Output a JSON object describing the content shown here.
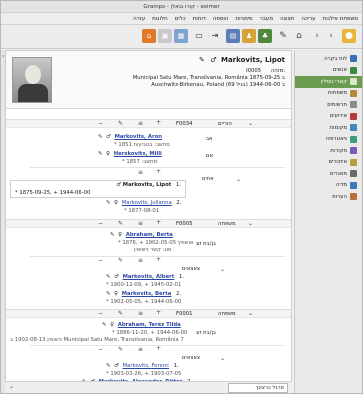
{
  "window": {
    "title": "Gramps - קורו גנאלן - eximer"
  },
  "menu": [
    "משפחת אילנות",
    "עריכה",
    "תצוגה",
    "מעבר",
    "סימניות",
    "הוספה",
    "דוחות",
    "כלים",
    "חלונות",
    "עזרה"
  ],
  "toolbar": {
    "icons": [
      "person-add-icon",
      "family-icon",
      "tree-icon",
      "edit-icon",
      "back-icon",
      "forward-icon",
      "home-icon",
      "tag-icon",
      "print-icon",
      "config-icon",
      "export-icon",
      "refresh-icon",
      "chart-icon",
      "bookmark-icon",
      "view-icon"
    ]
  },
  "sidebar": {
    "items": [
      {
        "label": "לוח בקרה",
        "color": "#3b6fb7"
      },
      {
        "label": "אנשים",
        "color": "#3b8a3b"
      },
      {
        "label": "קשרי גומלין",
        "color": "#5b8a34",
        "active": true
      },
      {
        "label": "משפחות",
        "color": "#b78a3b"
      },
      {
        "label": "תרשימים",
        "color": "#8a8a8a"
      },
      {
        "label": "אירועים",
        "color": "#b73b3b"
      },
      {
        "label": "מקומות",
        "color": "#3b8ab7"
      },
      {
        "label": "גיאוגרפיה",
        "color": "#3ba07a"
      },
      {
        "label": "מקורות",
        "color": "#7a5bb7"
      },
      {
        "label": "איזכורים",
        "color": "#b7a03b"
      },
      {
        "label": "מאגרים",
        "color": "#6a6a6a"
      },
      {
        "label": "מדיה",
        "color": "#3b7ab7"
      },
      {
        "label": "הערות",
        "color": "#b7703b"
      }
    ]
  },
  "person": {
    "name": "Markovits, Lipot",
    "id_label": "מזהה:",
    "id": "I0005",
    "birth": "Municipal Satu Mare, Transilvania, România ב 1875-09-25",
    "death": "Auschwitz-Birkenau, Poland ב 1944-06-00 (בגיל 69)"
  },
  "parents": {
    "section_label": "הוריים",
    "id": "F0034",
    "father_label": "אב",
    "father": "Markovits, Aron",
    "father_note": "* מחשב: בטביעות 1851",
    "mother_label": "אם",
    "mother": "Herskovits, Milli",
    "mother_note": "* מחשב: 1857",
    "siblings_label": "אחים",
    "sib1_num": "1.",
    "sib1": "Markovits, Lipot",
    "sib1_dates": "* 1875-09-25, + 1944-06-00",
    "sib2_num": "2.",
    "sib2": "Markovits, Julianna",
    "sib2_dates": "* 1877-08-01"
  },
  "family1": {
    "id": "F0005",
    "section_label": "משפחה",
    "spouse_label": "בן/בת זוג",
    "spouse": "Abraham, Berta",
    "spouse_dates": "* 1876, + אושוויץ 1902-05-05",
    "type_note": "סוג: קשר נישואין",
    "children_label": "צאצאים",
    "ch1_num": "1.",
    "ch1": "Markovits, Albert",
    "ch1_dates": "* 1900-12-09, + 1945-02-01",
    "ch2_num": "2.",
    "ch2": "Markovits, Berta",
    "ch2_dates": "* 1902-05-05, + 1944-06-00"
  },
  "family2": {
    "id": "F0001",
    "section_label": "משפחה",
    "spouse_label": "בן/בת זוג",
    "spouse": "Abraham, Teréz Tilda",
    "spouse_dates": "* 1886-11-20, + 1944-06-00",
    "marriage_note": "נישואין 1902-08-13 ב Municipal Satu Mare, Transilvania, România 7",
    "children_label": "צאצאים",
    "ch1_num": "1.",
    "ch1": "Markovits, Ferenc",
    "ch1_dates": "* 1903-03-26, + 1903-07-05",
    "ch2_num": "2.",
    "ch2": "Markovits, Alexander, Ritter"
  },
  "status": {
    "label": "סרגל כרצונך",
    "selector": "⌄"
  }
}
